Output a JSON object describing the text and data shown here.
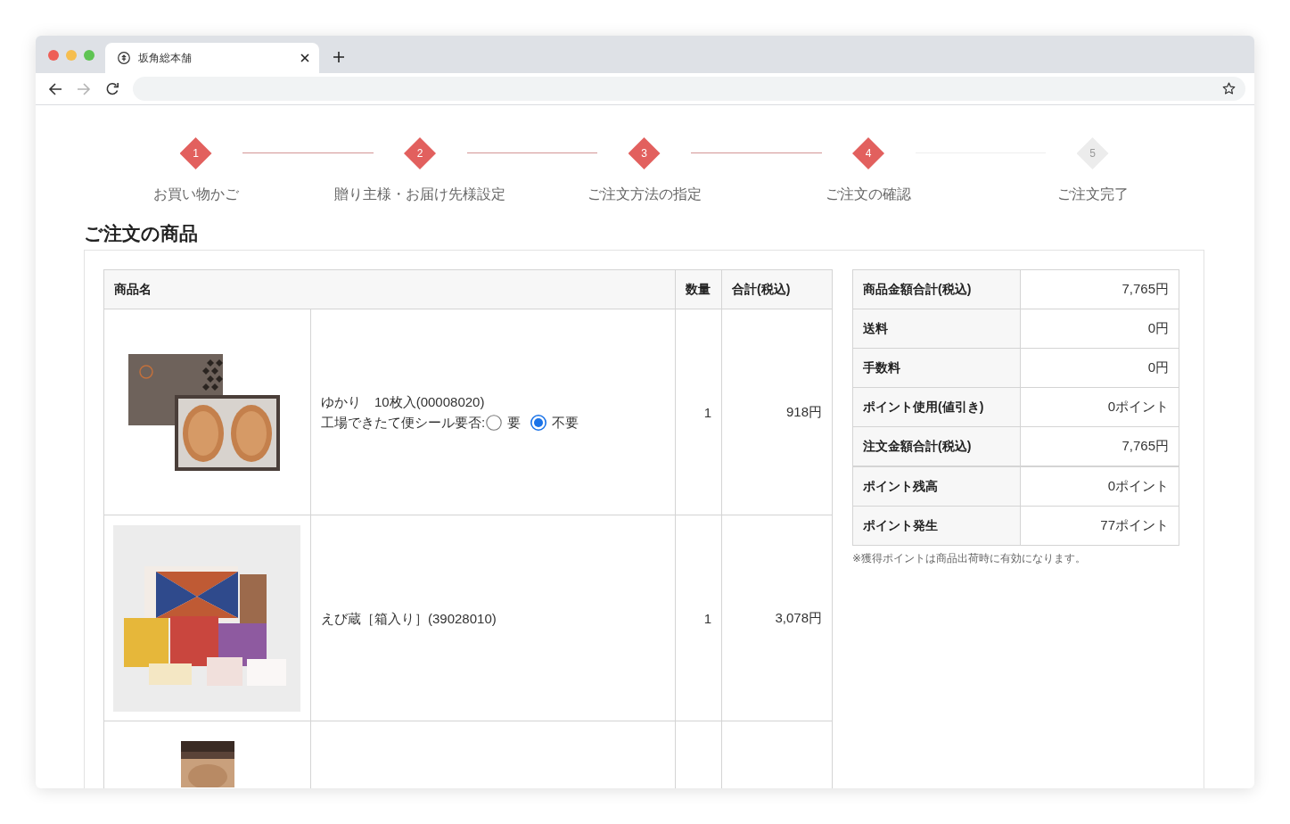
{
  "browser": {
    "tabs": [
      {
        "title": "坂角総本舗",
        "selected": true
      }
    ],
    "toolbar": [
      {
        "kind": "back",
        "disabled": false
      },
      {
        "kind": "forward",
        "disabled": true
      },
      {
        "kind": "reload",
        "disabled": false
      }
    ]
  },
  "steps": [
    {
      "number": "1",
      "label": "お買い物かご",
      "reached": true
    },
    {
      "number": "2",
      "label": "贈り主様・お届け先様設定",
      "reached": true
    },
    {
      "number": "3",
      "label": "ご注文方法の指定",
      "reached": true
    },
    {
      "number": "4",
      "label": "ご注文の確認",
      "reached": true
    },
    {
      "number": "5",
      "label": "ご注文完了",
      "reached": false
    }
  ],
  "section_title": "ご注文の商品",
  "order_table": {
    "columns": [
      "商品名",
      "数量",
      "合計(税込)"
    ],
    "rows": [
      {
        "kind": "product",
        "name": "ゆかり　10枚入(00008020)",
        "option": {
          "question": "工場できたて便シール要否:",
          "choices": [
            {
              "label": "要",
              "selected": false
            },
            {
              "label": "不要",
              "selected": true
            }
          ]
        },
        "quantity": "1",
        "total": "918円"
      },
      {
        "kind": "product",
        "name": "えび蔵［箱入り］(39028010)",
        "quantity": "1",
        "total": "3,078円"
      },
      {
        "kind": "partial"
      }
    ]
  },
  "summary": {
    "groups": [
      {
        "rows": [
          {
            "label": "商品金額合計(税込)",
            "value": "7,765円"
          },
          {
            "label": "送料",
            "value": "0円"
          },
          {
            "label": "手数料",
            "value": "0円"
          },
          {
            "label": "ポイント使用(値引き)",
            "value": "0ポイント"
          },
          {
            "label": "注文金額合計(税込)",
            "value": "7,765円"
          }
        ]
      },
      {
        "rows": [
          {
            "label": "ポイント残高",
            "value": "0ポイント"
          },
          {
            "label": "ポイント発生",
            "value": "77ポイント"
          }
        ]
      }
    ],
    "note": "※獲得ポイントは商品出荷時に有効になります。"
  }
}
